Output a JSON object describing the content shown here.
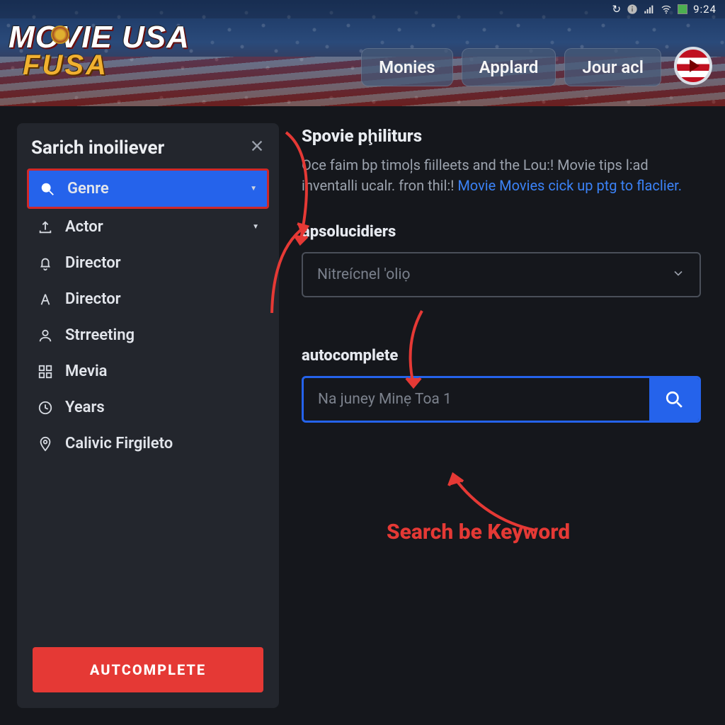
{
  "status": {
    "time": "9:24"
  },
  "logo": {
    "line1": "MOVIE USA",
    "line2": "FUSA"
  },
  "nav": {
    "items": [
      "Monies",
      "Applard",
      "Jour acl"
    ]
  },
  "sidebar": {
    "title": "Sarich inoiliever",
    "filters": [
      {
        "label": "Genre",
        "icon": "search",
        "selected": true,
        "chevron": true
      },
      {
        "label": "Actor",
        "icon": "upload",
        "selected": false,
        "chevron": true
      },
      {
        "label": "Director",
        "icon": "bell",
        "selected": false,
        "chevron": false
      },
      {
        "label": "Director",
        "icon": "text",
        "selected": false,
        "chevron": false
      },
      {
        "label": "Strreeting",
        "icon": "person",
        "selected": false,
        "chevron": false
      },
      {
        "label": "Mevia",
        "icon": "grid",
        "selected": false,
        "chevron": false
      },
      {
        "label": "Years",
        "icon": "clock",
        "selected": false,
        "chevron": false
      },
      {
        "label": "Calivic Firgileto",
        "icon": "pin",
        "selected": false,
        "chevron": false
      }
    ],
    "button": "AUTCOMPLETE"
  },
  "main": {
    "heading": "Spovie pḩiliturs",
    "desc_part1": "Oce faim bp timoļs fiilleets and the Lou:! Movie tips l:ad inventalli ucalr. fron thil:! ",
    "desc_link": "Movie Movies cick up ptg to flaclier.",
    "section1_label": "apsolucidiers",
    "dropdown_placeholder": "Nitreícnel 'oliọ",
    "section2_label": "autocomplete",
    "search_placeholder": "Na juney Minẹ Toa 1",
    "annotation": "Search be Keyword"
  },
  "colors": {
    "accent": "#2563eb",
    "danger": "#e53935"
  }
}
